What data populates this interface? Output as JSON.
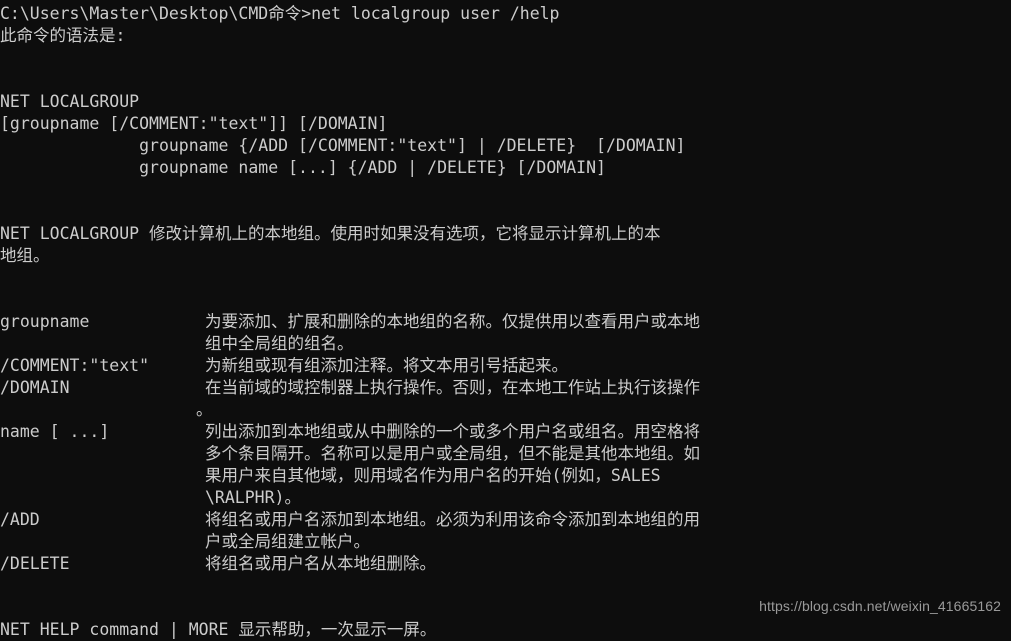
{
  "terminal": {
    "background_color": "#0d0d0d",
    "text_color": "#cccccc",
    "prompt_line": "C:\\Users\\Master\\Desktop\\CMD命令>net localgroup user /help",
    "intro_line": "此命令的语法是:",
    "syntax": {
      "header": "NET LOCALGROUP",
      "lines": [
        "[groupname [/COMMENT:\"text\"]] [/DOMAIN]",
        "              groupname {/ADD [/COMMENT:\"text\"] | /DELETE}  [/DOMAIN]",
        "              groupname name [...] {/ADD | /DELETE} [/DOMAIN]"
      ]
    },
    "description": [
      "NET LOCALGROUP 修改计算机上的本地组。使用时如果没有选项，它将显示计算机上的本",
      "地组。"
    ],
    "parameters": [
      {
        "term": "groupname",
        "desc_lines": [
          "为要添加、扩展和删除的本地组的名称。仅提供用以查看用户或本地",
          "组中全局组的组名。"
        ]
      },
      {
        "term": "/COMMENT:\"text\"",
        "desc_lines": [
          "为新组或现有组添加注释。将文本用引号括起来。"
        ]
      },
      {
        "term": "/DOMAIN",
        "desc_lines": [
          "在当前域的域控制器上执行操作。否则，在本地工作站上执行该操作",
          "。"
        ]
      },
      {
        "term": "name [ ...]",
        "desc_lines": [
          "列出添加到本地组或从中删除的一个或多个用户名或组名。用空格将",
          "多个条目隔开。名称可以是用户或全局组，但不能是其他本地组。如",
          "果用户来自其他域，则用域名作为用户名的开始(例如，SALES",
          "\\RALPHR)。"
        ]
      },
      {
        "term": "/ADD",
        "desc_lines": [
          "将组名或用户名添加到本地组。必须为利用该命令添加到本地组的用",
          "户或全局组建立帐户。"
        ]
      },
      {
        "term": "/DELETE",
        "desc_lines": [
          "将组名或用户名从本地组删除。"
        ]
      }
    ],
    "footer_line": "NET HELP command | MORE 显示帮助，一次显示一屏。"
  },
  "watermark": {
    "text": "https://blog.csdn.net/weixin_41665162",
    "color": "#9a9a9a"
  }
}
